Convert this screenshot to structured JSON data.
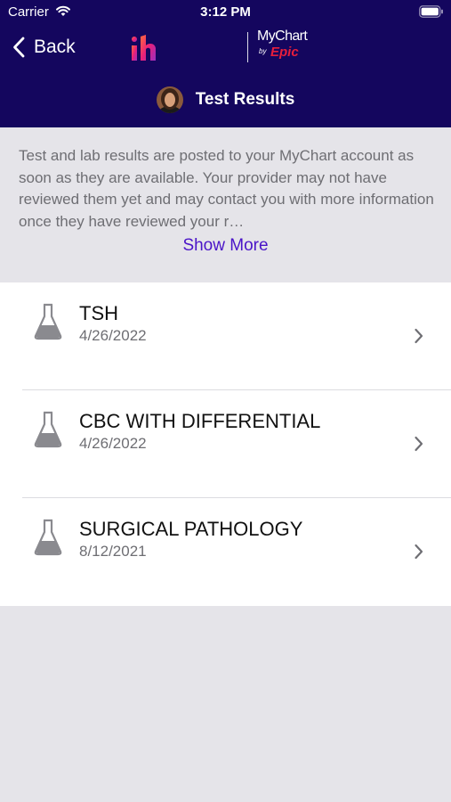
{
  "status_bar": {
    "carrier": "Carrier",
    "time": "3:12 PM"
  },
  "header": {
    "back_label": "Back",
    "brand_logo_text": "ih",
    "mychart_logo": {
      "mychart": "MyChart",
      "by": "by",
      "epic": "Epic"
    },
    "title": "Test Results"
  },
  "info": {
    "text": "Test and lab results are posted to your MyChart account as soon as they are available. Your provider may not have reviewed them yet and may contact you with more information once they have reviewed your r…",
    "show_more_label": "Show More"
  },
  "results": [
    {
      "name": "TSH",
      "date": "4/26/2022",
      "icon": "flask-icon"
    },
    {
      "name": "CBC WITH DIFFERENTIAL",
      "date": "4/26/2022",
      "icon": "flask-icon"
    },
    {
      "name": "SURGICAL PATHOLOGY",
      "date": "8/12/2021",
      "icon": "flask-icon"
    }
  ],
  "colors": {
    "header_bg": "#14065e",
    "accent_link": "#4a14c8",
    "epic_red": "#e61e3c",
    "brand_pink": "#e8207a",
    "background_gray": "#e5e4e9"
  }
}
